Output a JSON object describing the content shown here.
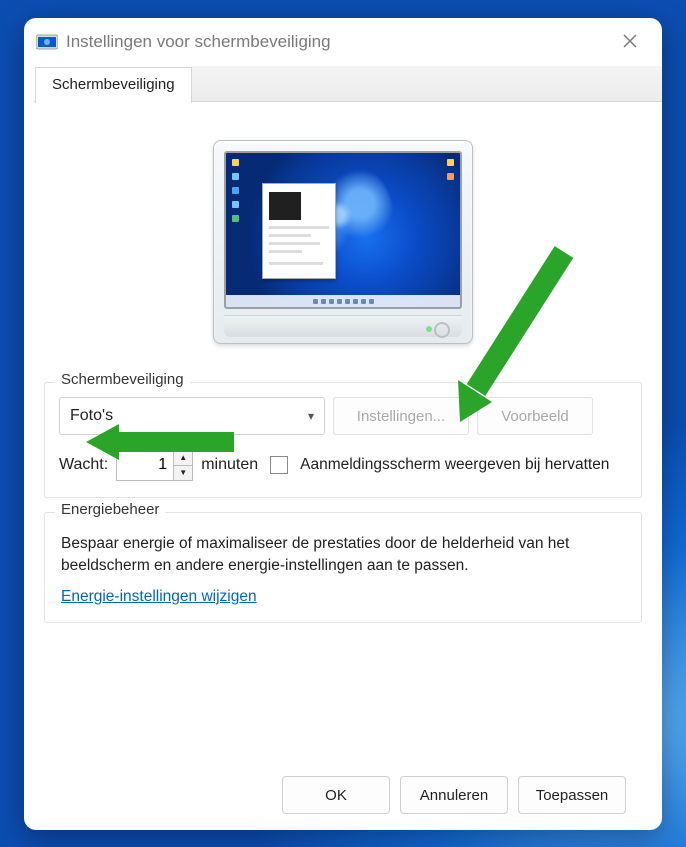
{
  "window": {
    "title": "Instellingen voor schermbeveiliging"
  },
  "tabs": {
    "active": "Schermbeveiliging"
  },
  "screensaver_group": {
    "legend": "Schermbeveiliging",
    "selected": "Foto's",
    "settings_button": "Instellingen...",
    "preview_button": "Voorbeeld",
    "wait_label": "Wacht:",
    "wait_value": "1",
    "minutes_label": "minuten",
    "resume_label": "Aanmeldingsscherm weergeven bij hervatten"
  },
  "energy_group": {
    "legend": "Energiebeheer",
    "description": "Bespaar energie of maximaliseer de prestaties door de helderheid van het beeldscherm en andere energie-instellingen aan te passen.",
    "link": "Energie-instellingen wijzigen"
  },
  "footer": {
    "ok": "OK",
    "cancel": "Annuleren",
    "apply": "Toepassen"
  }
}
